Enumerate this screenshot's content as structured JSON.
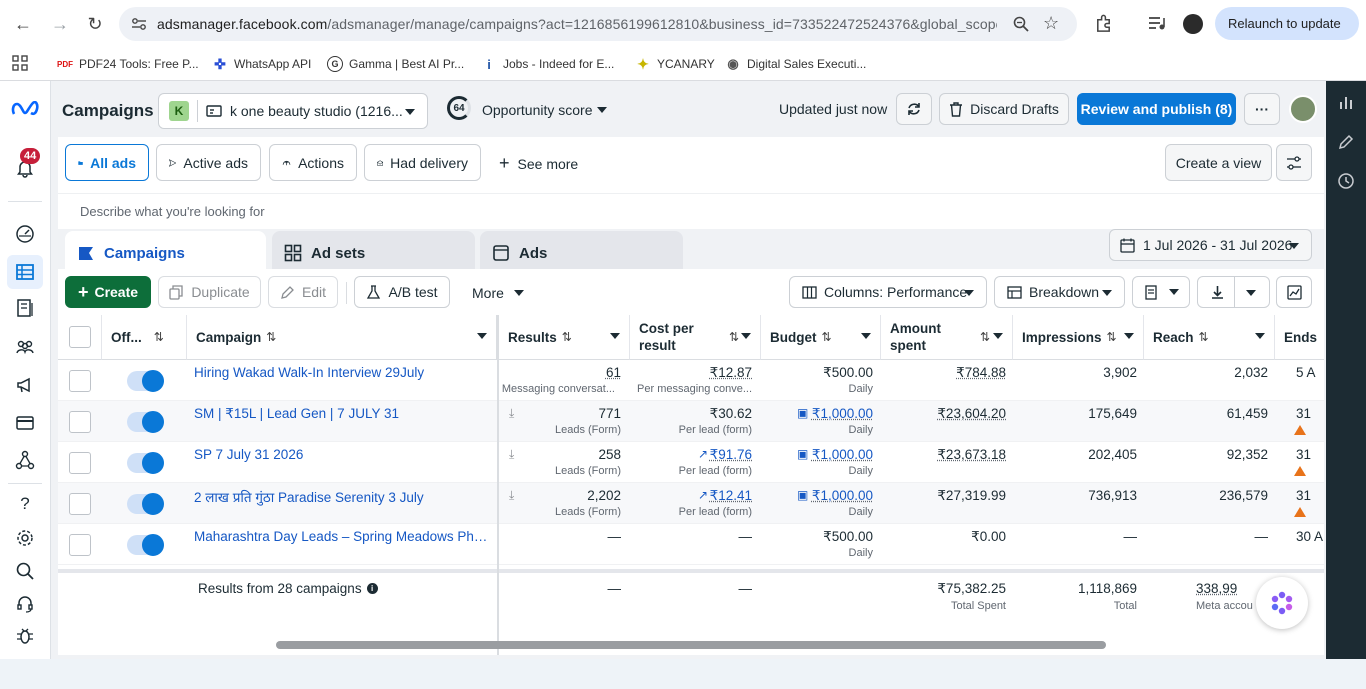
{
  "browser": {
    "url_host": "adsmanager.facebook.com",
    "url_path": "/adsmanager/manage/campaigns?act=1216856199612810&business_id=733522472524376&global_scope_...",
    "relaunch_label": "Relaunch to update",
    "bookmarks": [
      {
        "label": "PDF24 Tools: Free P...",
        "icon": "pdf24-icon"
      },
      {
        "label": "WhatsApp API",
        "icon": "c-logo-icon"
      },
      {
        "label": "Gamma | Best AI Pr...",
        "icon": "g-logo-icon"
      },
      {
        "label": "Jobs - Indeed for E...",
        "icon": "indeed-icon"
      },
      {
        "label": "YCANARY",
        "icon": "canary-icon"
      },
      {
        "label": "Digital Sales Executi...",
        "icon": "globe-icon"
      }
    ]
  },
  "sidebar": {
    "notification_count": "44"
  },
  "header": {
    "title": "Campaigns",
    "account_initial": "K",
    "account_name": "k one beauty studio (1216...",
    "opportunity_score": "64",
    "opportunity_label": "Opportunity score",
    "updated_text": "Updated just now",
    "discard_label": "Discard Drafts",
    "review_label": "Review and publish (8)",
    "more_label": "···"
  },
  "filters": {
    "chips": [
      "All ads",
      "Active ads",
      "Actions",
      "Had delivery"
    ],
    "see_more": "See more",
    "create_view": "Create a view"
  },
  "search": {
    "placeholder": "Describe what you're looking for"
  },
  "tabs": {
    "campaigns": "Campaigns",
    "adsets": "Ad sets",
    "ads": "Ads"
  },
  "date_range": "1 Jul 2026 - 31 Jul 2026",
  "toolbar": {
    "create": "Create",
    "duplicate": "Duplicate",
    "edit": "Edit",
    "ab_test": "A/B test",
    "more": "More",
    "columns": "Columns: Performance",
    "breakdown": "Breakdown"
  },
  "table": {
    "headers": {
      "off": "Off...",
      "campaign": "Campaign",
      "results": "Results",
      "cost_per_result_1": "Cost per",
      "cost_per_result_2": "result",
      "budget": "Budget",
      "amount_spent_1": "Amount",
      "amount_spent_2": "spent",
      "impressions": "Impressions",
      "reach": "Reach",
      "ends": "Ends"
    },
    "rows": [
      {
        "name": "Hiring Wakad Walk-In Interview 29July",
        "results": "61",
        "results_sub": "Messaging conversat...",
        "cost": "₹12.87",
        "cost_sub": "Per messaging conve...",
        "budget": "₹500.00",
        "budget_sub": "Daily",
        "spent": "₹784.88",
        "impressions": "3,902",
        "reach": "2,032",
        "ends": "5 A"
      },
      {
        "name": "SM | ₹15L | Lead Gen | 7 JULY 31",
        "results": "771",
        "results_sub": "Leads (Form)",
        "cost": "₹30.62",
        "cost_sub": "Per lead (form)",
        "budget": "₹1,000.00",
        "budget_sub": "Daily",
        "spent": "₹23,604.20",
        "impressions": "175,649",
        "reach": "61,459",
        "ends": "31"
      },
      {
        "name": "SP 7 July 31 2026",
        "results": "258",
        "results_sub": "Leads (Form)",
        "cost": "₹91.76",
        "cost_sub": "Per lead (form)",
        "budget": "₹1,000.00",
        "budget_sub": "Daily",
        "spent": "₹23,673.18",
        "impressions": "202,405",
        "reach": "92,352",
        "ends": "31"
      },
      {
        "name": "2 लाख प्रति गुंठा Paradise Serenity 3 July",
        "results": "2,202",
        "results_sub": "Leads (Form)",
        "cost": "₹12.41",
        "cost_sub": "Per lead (form)",
        "budget": "₹1,000.00",
        "budget_sub": "Daily",
        "spent": "₹27,319.99",
        "impressions": "736,913",
        "reach": "236,579",
        "ends": "31"
      },
      {
        "name": "Maharashtra Day Leads – Spring Meadows Phase...",
        "results": "—",
        "results_sub": "",
        "cost": "—",
        "cost_sub": "",
        "budget": "₹500.00",
        "budget_sub": "Daily",
        "spent": "₹0.00",
        "impressions": "—",
        "reach": "—",
        "ends": "30 A"
      }
    ],
    "footer": {
      "label": "Results from 28 campaigns",
      "results": "—",
      "cost": "—",
      "spent": "₹75,382.25",
      "spent_sub": "Total Spent",
      "impressions": "1,118,869",
      "impressions_sub": "Total",
      "reach": "338,99",
      "reach_sub": "Meta accou"
    }
  }
}
